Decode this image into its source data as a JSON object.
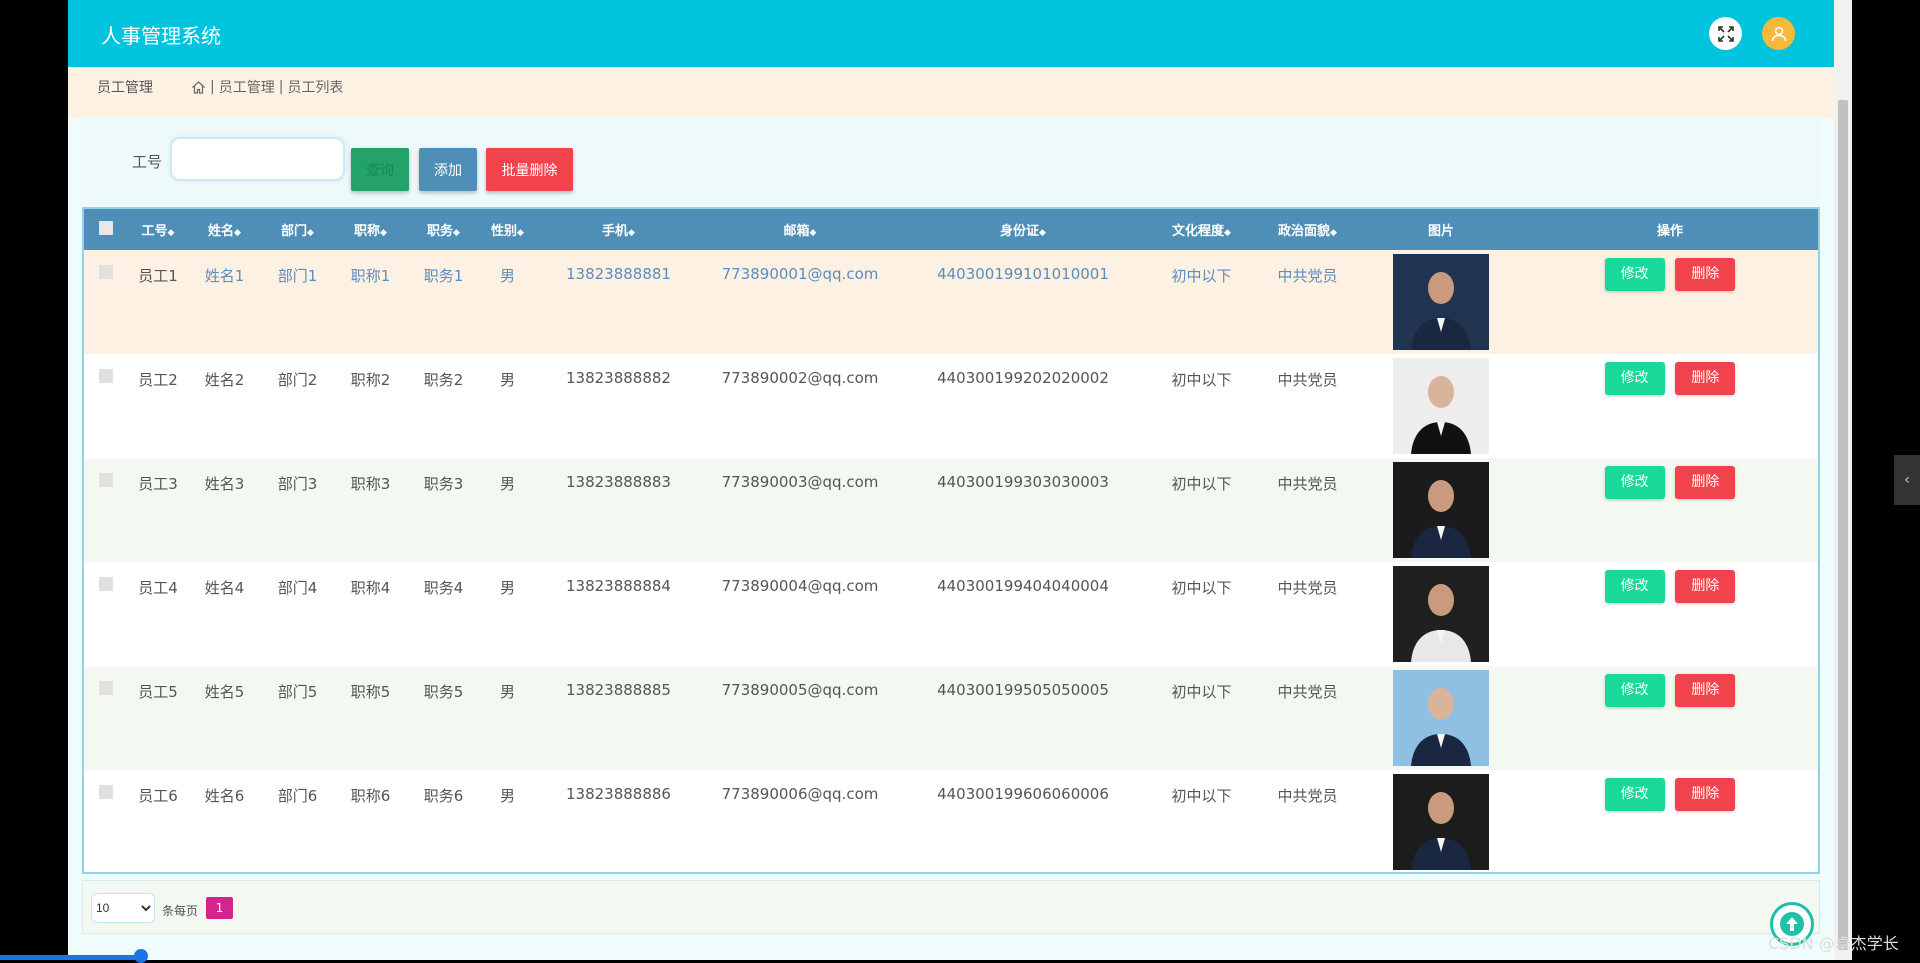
{
  "app": {
    "title": "人事管理系统"
  },
  "header": {
    "fullscreen_icon": "fullscreen-icon",
    "user_icon": "user-icon",
    "accent": "#00c4de"
  },
  "breadcrumb": {
    "section": "员工管理",
    "sep1": "|",
    "level1": "员工管理",
    "sep2": "|",
    "level2": "员工列表"
  },
  "search": {
    "label": "工号",
    "value": "",
    "query_label": "查询",
    "add_label": "添加",
    "batch_delete_label": "批量删除"
  },
  "table": {
    "columns": [
      "工号",
      "姓名",
      "部门",
      "职称",
      "职务",
      "性别",
      "手机",
      "邮箱",
      "身份证",
      "文化程度",
      "政治面貌",
      "图片",
      "操作"
    ],
    "edit_label": "修改",
    "delete_label": "删除",
    "rows": [
      {
        "id": "员工1",
        "name": "姓名1",
        "dept": "部门1",
        "title": "职称1",
        "post": "职务1",
        "gender": "男",
        "phone": "13823888881",
        "email": "773890001@qq.com",
        "idcard": "440300199101010001",
        "education": "初中以下",
        "politics": "中共党员",
        "photo_bg": "#21344f"
      },
      {
        "id": "员工2",
        "name": "姓名2",
        "dept": "部门2",
        "title": "职称2",
        "post": "职务2",
        "gender": "男",
        "phone": "13823888882",
        "email": "773890002@qq.com",
        "idcard": "440300199202020002",
        "education": "初中以下",
        "politics": "中共党员",
        "photo_bg": "#eeeeee"
      },
      {
        "id": "员工3",
        "name": "姓名3",
        "dept": "部门3",
        "title": "职称3",
        "post": "职务3",
        "gender": "男",
        "phone": "13823888883",
        "email": "773890003@qq.com",
        "idcard": "440300199303030003",
        "education": "初中以下",
        "politics": "中共党员",
        "photo_bg": "#1b1b1d"
      },
      {
        "id": "员工4",
        "name": "姓名4",
        "dept": "部门4",
        "title": "职称4",
        "post": "职务4",
        "gender": "男",
        "phone": "13823888884",
        "email": "773890004@qq.com",
        "idcard": "440300199404040004",
        "education": "初中以下",
        "politics": "中共党员",
        "photo_bg": "#202020"
      },
      {
        "id": "员工5",
        "name": "姓名5",
        "dept": "部门5",
        "title": "职称5",
        "post": "职务5",
        "gender": "男",
        "phone": "13823888885",
        "email": "773890005@qq.com",
        "idcard": "440300199505050005",
        "education": "初中以下",
        "politics": "中共党员",
        "photo_bg": "#8fbfe3"
      },
      {
        "id": "员工6",
        "name": "姓名6",
        "dept": "部门6",
        "title": "职称6",
        "post": "职务6",
        "gender": "男",
        "phone": "13823888886",
        "email": "773890006@qq.com",
        "idcard": "440300199606060006",
        "education": "初中以下",
        "politics": "中共党员",
        "photo_bg": "#1c1c1c"
      }
    ]
  },
  "pagination": {
    "page_size": "10",
    "per_page_label": "条每页",
    "current_page": "1"
  },
  "watermark": "CSDN @卓杰学长"
}
